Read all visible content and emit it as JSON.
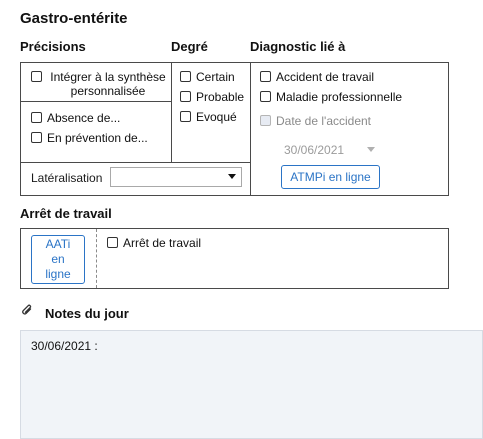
{
  "title": "Gastro-entérite",
  "headers": {
    "precisions": "Précisions",
    "degre": "Degré",
    "diagnostic": "Diagnostic lié à"
  },
  "precisions": {
    "integrer": "Intégrer à la synthèse personnalisée",
    "absence": "Absence de...",
    "prevention": "En prévention de...",
    "lateralisation_label": "Latéralisation",
    "lateralisation_value": ""
  },
  "degre": {
    "certain": "Certain",
    "probable": "Probable",
    "evoque": "Evoqué"
  },
  "diagnostic": {
    "accident": "Accident de travail",
    "maladie": "Maladie professionnelle",
    "date_label": "Date de l'accident",
    "date_value": "30/06/2021",
    "atmpi_button": "ATMPi en ligne"
  },
  "arret": {
    "section_title": "Arrêt de travail",
    "aati_button": "AATi en ligne",
    "checkbox": "Arrêt de travail"
  },
  "notes": {
    "section_title": "Notes du jour",
    "icon": "paperclip-icon",
    "content": "30/06/2021 :"
  },
  "colors": {
    "accent": "#2b74c6",
    "border": "#4a4a4a",
    "notes_bg": "#f1f4f8"
  }
}
